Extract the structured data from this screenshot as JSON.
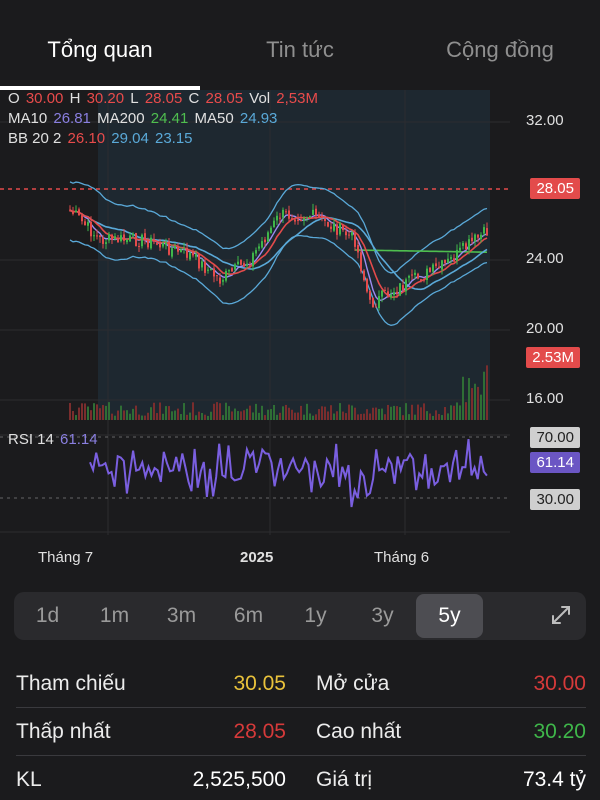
{
  "tabs": [
    {
      "label": "Tổng quan",
      "active": true
    },
    {
      "label": "Tin tức",
      "active": false
    },
    {
      "label": "Cộng đồng",
      "active": false
    }
  ],
  "legend": {
    "ohlc": {
      "o_label": "O",
      "o": "30.00",
      "h_label": "H",
      "h": "30.20",
      "l_label": "L",
      "l": "28.05",
      "c_label": "C",
      "c": "28.05",
      "vol_label": "Vol",
      "vol": "2,53M"
    },
    "ma": {
      "ma10_label": "MA10",
      "ma10": "26.81",
      "ma200_label": "MA200",
      "ma200": "24.41",
      "ma50_label": "MA50",
      "ma50": "24.93"
    },
    "bb": {
      "label": "BB 20 2",
      "v1": "26.10",
      "v2": "29.04",
      "v3": "23.15"
    },
    "rsi": {
      "label": "RSI 14",
      "value": "61.14"
    }
  },
  "price_axis": {
    "ticks": [
      "32.00",
      "24.00",
      "20.00",
      "16.00"
    ],
    "last_price": "28.05",
    "volume_tag": "2.53M"
  },
  "rsi_axis": {
    "upper": "70.00",
    "current": "61.14",
    "lower": "30.00"
  },
  "time_axis": {
    "labels": [
      "Tháng 7",
      "2025",
      "Tháng 6"
    ]
  },
  "range": {
    "buttons": [
      "1d",
      "1m",
      "3m",
      "6m",
      "1y",
      "3y",
      "5y"
    ],
    "selected": "5y"
  },
  "stats": {
    "ref_label": "Tham chiếu",
    "ref_value": "30.05",
    "open_label": "Mở cửa",
    "open_value": "30.00",
    "low_label": "Thấp nhất",
    "low_value": "28.05",
    "high_label": "Cao nhất",
    "high_value": "30.20",
    "vol_label": "KL",
    "vol_value": "2,525,500",
    "val_label": "Giá trị",
    "val_value": "73.4 tỷ"
  },
  "colors": {
    "up": "#3fb74a",
    "down": "#e34b4b",
    "ma10": "#8a7fe0",
    "ma200": "#4fbf4f",
    "ma50": "#5aa9d8",
    "rsi": "#7a5fe0",
    "ref": "#e9c23b"
  }
}
